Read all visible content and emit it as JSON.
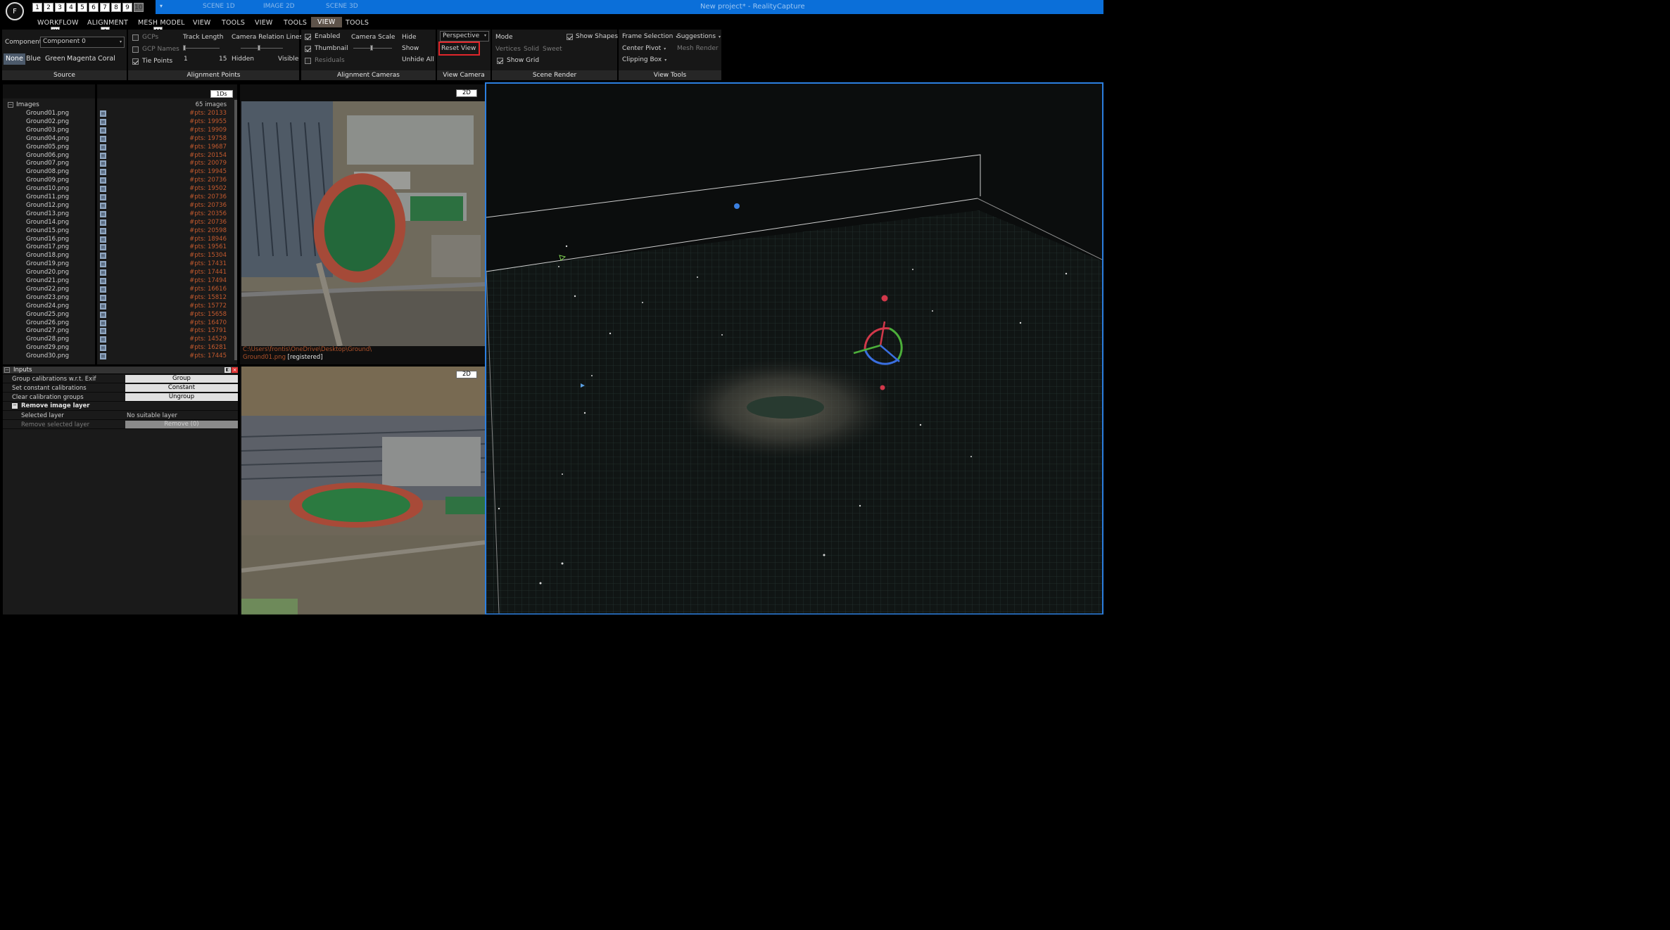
{
  "app": {
    "logo": "F",
    "layout_numbers": [
      "1",
      "2",
      "3",
      "4",
      "5",
      "6",
      "7",
      "8",
      "9",
      "10"
    ],
    "window_title": "New project* - RealityCapture",
    "scene_tabs": [
      "SCENE 1D",
      "IMAGE 2D",
      "SCENE 3D"
    ]
  },
  "menu": {
    "items": [
      "WORKFLOW",
      "ALIGNMENT",
      "MESH MODEL",
      "VIEW",
      "TOOLS",
      "VIEW",
      "TOOLS",
      "VIEW",
      "TOOLS"
    ],
    "active_index": 7,
    "hotkeys": [
      "W",
      "A",
      "M"
    ]
  },
  "ribbon": {
    "source": {
      "label": "Source",
      "component_label": "Component",
      "component_value": "Component 0",
      "colors": [
        "None",
        "Blue",
        "Green",
        "Magenta",
        "Coral"
      ],
      "selected_color": "None"
    },
    "alignment_points": {
      "label": "Alignment Points",
      "gcps": "GCPs",
      "gcp_names": "GCP Names",
      "tie_points": "Tie Points",
      "track_length": "Track Length",
      "track_min": "1",
      "track_max": "15",
      "camera_relation": "Camera Relation Lines",
      "relation_min": "Hidden",
      "relation_max": "Visible"
    },
    "alignment_cameras": {
      "label": "Alignment Cameras",
      "enabled": "Enabled",
      "thumbnail": "Thumbnail",
      "residuals": "Residuals",
      "camera_scale": "Camera Scale",
      "hide": "Hide",
      "show": "Show",
      "unhide_all": "Unhide All"
    },
    "view_camera": {
      "label": "View Camera",
      "projection": "Perspective",
      "reset_view": "Reset View"
    },
    "scene_render": {
      "label": "Scene Render",
      "mode": "Mode",
      "show_shapes": "Show Shapes",
      "vertices": "Vertices",
      "solid": "Solid",
      "sweet": "Sweet",
      "show_grid": "Show Grid"
    },
    "view_tools": {
      "label": "View Tools",
      "frame_selection": "Frame Selection",
      "suggestions": "Suggestions",
      "center_pivot": "Center Pivot",
      "mesh_render": "Mesh Render",
      "clipping_box": "Clipping Box"
    }
  },
  "image_list": {
    "view_tag": "1Ds",
    "root": "Images",
    "count": "65 images",
    "items": [
      {
        "name": "Ground01.png",
        "pts": "#pts: 20133"
      },
      {
        "name": "Ground02.png",
        "pts": "#pts: 19955"
      },
      {
        "name": "Ground03.png",
        "pts": "#pts: 19909"
      },
      {
        "name": "Ground04.png",
        "pts": "#pts: 19758"
      },
      {
        "name": "Ground05.png",
        "pts": "#pts: 19687"
      },
      {
        "name": "Ground06.png",
        "pts": "#pts: 20154"
      },
      {
        "name": "Ground07.png",
        "pts": "#pts: 20079"
      },
      {
        "name": "Ground08.png",
        "pts": "#pts: 19945"
      },
      {
        "name": "Ground09.png",
        "pts": "#pts: 20736"
      },
      {
        "name": "Ground10.png",
        "pts": "#pts: 19502"
      },
      {
        "name": "Ground11.png",
        "pts": "#pts: 20736"
      },
      {
        "name": "Ground12.png",
        "pts": "#pts: 20736"
      },
      {
        "name": "Ground13.png",
        "pts": "#pts: 20356"
      },
      {
        "name": "Ground14.png",
        "pts": "#pts: 20736"
      },
      {
        "name": "Ground15.png",
        "pts": "#pts: 20598"
      },
      {
        "name": "Ground16.png",
        "pts": "#pts: 18946"
      },
      {
        "name": "Ground17.png",
        "pts": "#pts: 19561"
      },
      {
        "name": "Ground18.png",
        "pts": "#pts: 15304"
      },
      {
        "name": "Ground19.png",
        "pts": "#pts: 17431"
      },
      {
        "name": "Ground20.png",
        "pts": "#pts: 17441"
      },
      {
        "name": "Ground21.png",
        "pts": "#pts: 17494"
      },
      {
        "name": "Ground22.png",
        "pts": "#pts: 16616"
      },
      {
        "name": "Ground23.png",
        "pts": "#pts: 15812"
      },
      {
        "name": "Ground24.png",
        "pts": "#pts: 15772"
      },
      {
        "name": "Ground25.png",
        "pts": "#pts: 15658"
      },
      {
        "name": "Ground26.png",
        "pts": "#pts: 16470"
      },
      {
        "name": "Ground27.png",
        "pts": "#pts: 15791"
      },
      {
        "name": "Ground28.png",
        "pts": "#pts: 14529"
      },
      {
        "name": "Ground29.png",
        "pts": "#pts: 16281"
      },
      {
        "name": "Ground30.png",
        "pts": "#pts: 17445"
      }
    ]
  },
  "inputs_panel": {
    "title": "Inputs",
    "rows": [
      {
        "label": "Group calibrations w.r.t. Exif",
        "button": "Group"
      },
      {
        "label": "Set constant calibrations",
        "button": "Constant"
      },
      {
        "label": "Clear calibration groups",
        "button": "Ungroup"
      }
    ],
    "section": "Remove image layer",
    "selected_layer_label": "Selected layer",
    "selected_layer_value": "No suitable layer",
    "remove_label": "Remove selected layer",
    "remove_button": "Remove (0)"
  },
  "image_view_top": {
    "tag": "2D",
    "path": "C:\\Users\\frontis\\OneDrive\\Desktop\\Ground\\",
    "file": "Ground01.png",
    "status": "[registered]"
  },
  "image_view_bottom": {
    "tag": "2D"
  },
  "colors": {
    "accent": "#0b6fd9",
    "view_border": "#2c7fe0",
    "highlight": "#e0262b",
    "pts": "#c45a2e"
  }
}
